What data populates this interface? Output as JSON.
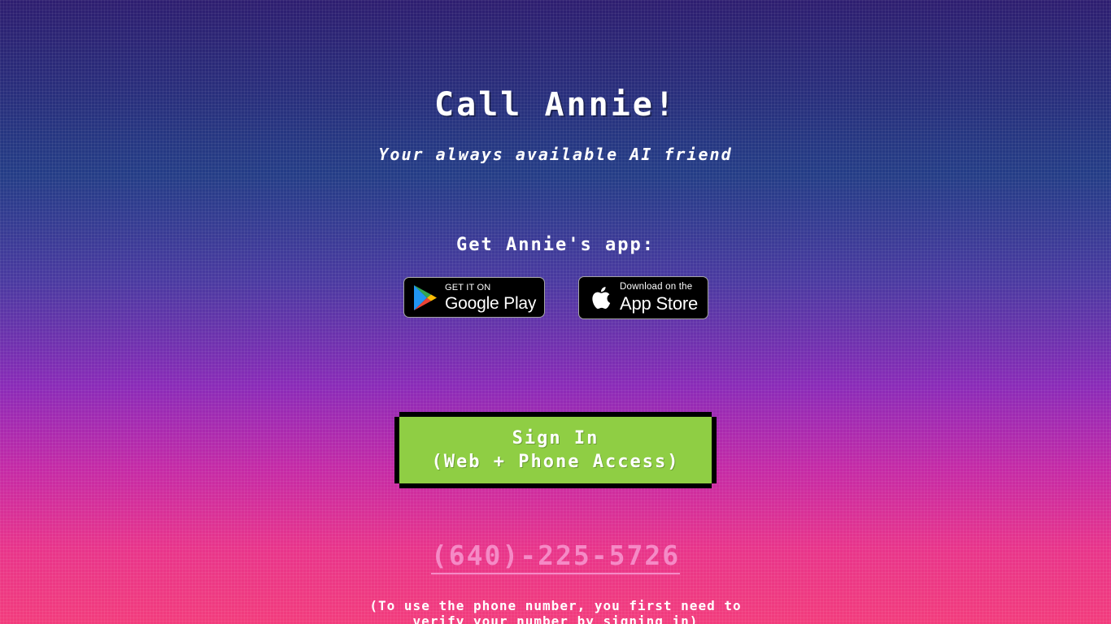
{
  "header": {
    "title": "Call Annie!",
    "subtitle": "Your always available AI friend"
  },
  "apps": {
    "heading": "Get Annie's app:",
    "google_play": {
      "small_text": "GET IT ON",
      "big_text": "Google Play",
      "icon": "google-play-icon"
    },
    "app_store": {
      "small_text": "Download on the",
      "big_text": "App Store",
      "icon": "apple-icon"
    }
  },
  "signin": {
    "line1": "Sign In",
    "line2": "(Web + Phone Access)",
    "color": "#8fce44"
  },
  "phone": {
    "number": "(640)-225-5726",
    "color": "#f58ac6"
  },
  "note": {
    "line1": "(To use the phone number, you first need to",
    "line2": "verify your number by signing in)"
  },
  "colors": {
    "background_top": "#2e1e70",
    "background_bottom": "#f23c7c"
  }
}
